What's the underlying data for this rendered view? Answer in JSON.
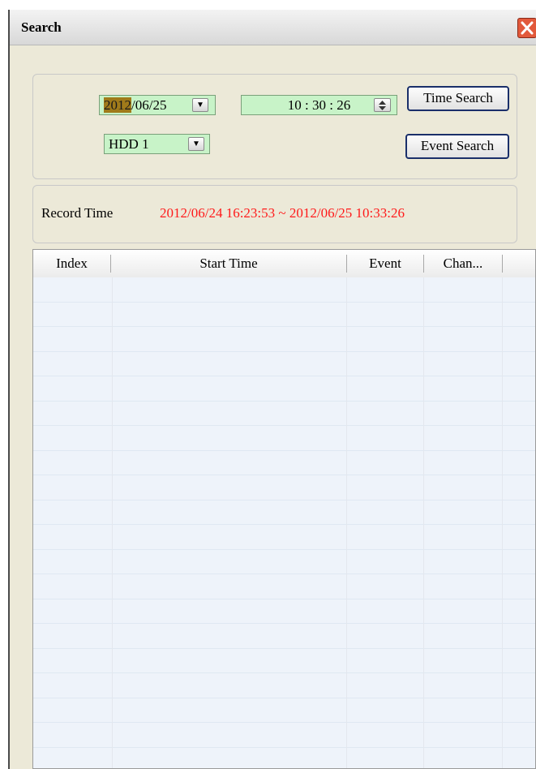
{
  "window": {
    "title": "Search"
  },
  "search": {
    "date_highlight": "2012",
    "date_rest": "/06/25",
    "time": "10 : 30 : 26",
    "drive": "HDD 1",
    "time_search_label": "Time Search",
    "event_search_label": "Event Search"
  },
  "record": {
    "label": "Record Time",
    "value": "2012/06/24 16:23:53 ~ 2012/06/25 10:33:26",
    "value_color": "#ff1a1a"
  },
  "list": {
    "columns": [
      "Index",
      "Start Time",
      "Event",
      "Chan..."
    ],
    "rows": []
  }
}
